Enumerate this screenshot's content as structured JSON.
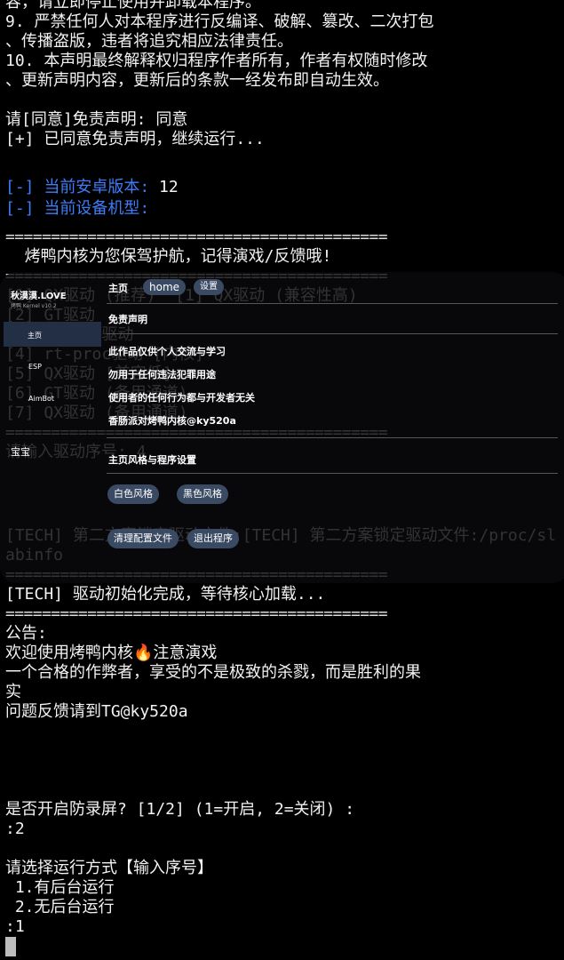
{
  "terminal": {
    "lines_top": [
      {
        "text": "容，请立即停止使用并卸载本程序。",
        "cls": "white"
      },
      {
        "text": "9. 严禁任何人对本程序进行反编译、破解、篡改、二次打包",
        "cls": "white"
      },
      {
        "text": "、传播盗版，违者将追究相应法律责任。",
        "cls": "white"
      },
      {
        "text": "10. 本声明最终解释权归程序作者所有，作者有权随时修改",
        "cls": "white"
      },
      {
        "text": "、更新声明内容，更新后的条款一经发布即自动生效。",
        "cls": "white"
      },
      {
        "text": "",
        "cls": "white"
      },
      {
        "text": "请[同意]免责声明: 同意",
        "cls": "white"
      },
      {
        "text": "[+] 已同意免责声明，继续运行...",
        "cls": "white"
      },
      {
        "text": "",
        "cls": "white"
      },
      {
        "text": "",
        "cls": "white"
      },
      {
        "text": "",
        "cls": "white"
      },
      {
        "text": "",
        "cls": "white"
      },
      {
        "text": "==========================================",
        "cls": "sep"
      },
      {
        "text": "  烤鸭内核为您保驾护航，记得演戏/反馈哦!",
        "cls": "white"
      },
      {
        "text": "==========================================",
        "cls": "sep"
      },
      {
        "text": "[1] QX驱动 (推荐)  [1] QX驱动 (兼容性高)",
        "cls": "dim"
      },
      {
        "text": "[2] GT驱动",
        "cls": "dim"
      },
      {
        "text": "[3] rt-dev驱动",
        "cls": "dim"
      },
      {
        "text": "[4] rt-proc驱动 [内核]",
        "cls": "dim"
      },
      {
        "text": "[5] QX驱动 [兼容低]",
        "cls": "dim"
      },
      {
        "text": "[6] GT驱动 (备用通道)",
        "cls": "dim"
      },
      {
        "text": "[7] QX驱动 (备用通道)",
        "cls": "dim"
      },
      {
        "text": "==========================================",
        "cls": "sep"
      },
      {
        "text": "请输入驱动序号: 4",
        "cls": "dim"
      }
    ],
    "android_label": "[-] 当前安卓版本:",
    "android_value": " 12",
    "device_label": "[-] 当前设备机型:",
    "tech_lines": [
      {
        "text": "[TECH] 第二方案锁定驱动文件:[TECH] 第二方案锁定驱动文件:/proc/slabinfo",
        "cls": "dim"
      }
    ],
    "lines_bottom": [
      {
        "text": "==========================================",
        "cls": "sep"
      },
      {
        "text": "[TECH] 驱动初始化完成，等待核心加载...",
        "cls": "white"
      },
      {
        "text": "==========================================",
        "cls": "sep"
      },
      {
        "text": "公告:",
        "cls": "white"
      },
      {
        "text": "欢迎使用烤鸭内核🔥注意演戏",
        "cls": "white"
      },
      {
        "text": "一个合格的作弊者，享受的不是极致的杀戮，而是胜利的果",
        "cls": "white"
      },
      {
        "text": "实",
        "cls": "white"
      },
      {
        "text": "问题反馈请到TG@ky520a",
        "cls": "white"
      },
      {
        "text": "",
        "cls": "white"
      },
      {
        "text": "",
        "cls": "white"
      },
      {
        "text": "",
        "cls": "white"
      },
      {
        "text": "",
        "cls": "white"
      },
      {
        "text": "是否开启防录屏? [1/2] (1=开启, 2=关闭) :",
        "cls": "white"
      },
      {
        "text": ":2",
        "cls": "white"
      },
      {
        "text": "",
        "cls": "white"
      },
      {
        "text": "请选择运行方式【输入序号】",
        "cls": "white"
      },
      {
        "text": " 1.有后台运行",
        "cls": "white"
      },
      {
        "text": " 2.无后台运行",
        "cls": "white"
      },
      {
        "text": ":1",
        "cls": "white"
      }
    ]
  },
  "menu": {
    "logo_title": "秋漠漠.LOVE",
    "logo_sub": "烤鸭 Kernel v10.2",
    "sidebar": [
      "主页",
      "ESP",
      "AimBot",
      "宝宝"
    ],
    "header_title": "主页",
    "header_pills": [
      "home",
      "设置"
    ],
    "disclaimer_title": "免责声明",
    "disclaimer_items": [
      "此作品仅供个人交流与学习",
      "勿用于任何违法犯罪用途",
      "使用者的任何行为都与开发者无关",
      "香肠派对烤鸭内核@ky520a"
    ],
    "style_title": "主页风格与程序设置",
    "style_buttons": [
      "白色风格",
      "黑色风格"
    ],
    "action_buttons": [
      "清理配置文件",
      "退出程序"
    ]
  }
}
